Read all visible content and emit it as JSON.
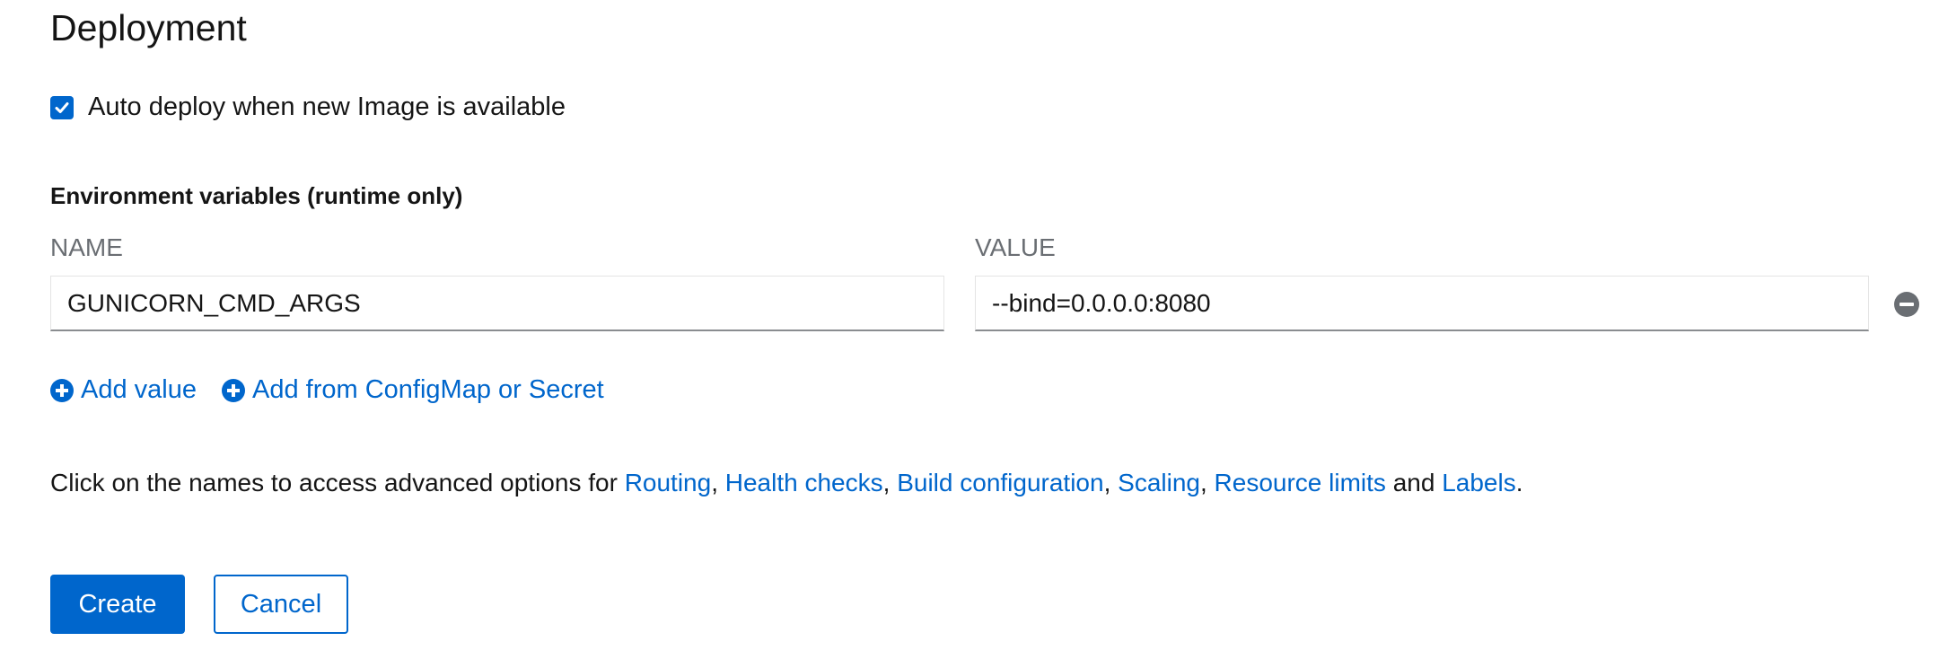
{
  "section": {
    "title": "Deployment"
  },
  "auto_deploy": {
    "label": "Auto deploy when new Image is available",
    "checked": true
  },
  "env": {
    "label": "Environment variables (runtime only)",
    "name_header": "NAME",
    "value_header": "VALUE",
    "rows": [
      {
        "name": "GUNICORN_CMD_ARGS",
        "value": "--bind=0.0.0.0:8080"
      }
    ],
    "add_value_label": "Add value",
    "add_from_label": "Add from ConfigMap or Secret"
  },
  "help": {
    "prefix": "Click on the names to access advanced options for ",
    "links": [
      "Routing",
      "Health checks",
      "Build configuration",
      "Scaling",
      "Resource limits",
      "Labels"
    ],
    "sep1": ", ",
    "sep2": ", ",
    "sep3": ", ",
    "sep4": ", ",
    "and_word": " and ",
    "suffix": "."
  },
  "actions": {
    "create_label": "Create",
    "cancel_label": "Cancel"
  },
  "colors": {
    "primary": "#0066cc",
    "muted": "#6a6e73"
  },
  "icons": {
    "checkbox": "check-icon",
    "remove": "minus-circle-icon",
    "add": "plus-circle-icon"
  }
}
